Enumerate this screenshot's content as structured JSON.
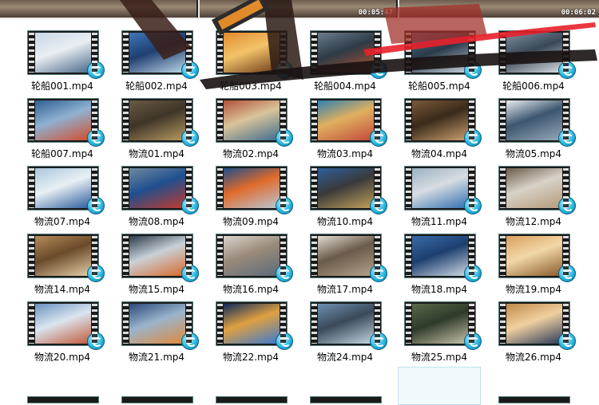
{
  "previews": [
    {
      "time": ""
    },
    {
      "time": "00:05:47"
    },
    {
      "time": "00:06:02"
    }
  ],
  "files": [
    {
      "name": "轮船001.mp4",
      "colors": [
        "#c9d8e6",
        "#4a6a8a",
        "#e9eef2"
      ]
    },
    {
      "name": "轮船002.mp4",
      "colors": [
        "#3e76b8",
        "#bcd6ea",
        "#1f3f70"
      ]
    },
    {
      "name": "轮船003.mp4",
      "colors": [
        "#e28a2b",
        "#6b3a17",
        "#f3c36a"
      ]
    },
    {
      "name": "轮船004.mp4",
      "colors": [
        "#6b7c8c",
        "#b5522f",
        "#2e3b47"
      ]
    },
    {
      "name": "轮船005.mp4",
      "colors": [
        "#59708a",
        "#c6d0d8",
        "#2a3a4a"
      ]
    },
    {
      "name": "轮船006.mp4",
      "colors": [
        "#7d8fa0",
        "#d6dde3",
        "#3a4856"
      ]
    },
    {
      "name": "轮船007.mp4",
      "colors": [
        "#2f5f91",
        "#d24c2a",
        "#8fb2d2"
      ]
    },
    {
      "name": "物流01.mp4",
      "colors": [
        "#6a5a45",
        "#b89a62",
        "#3e3528"
      ]
    },
    {
      "name": "物流02.mp4",
      "colors": [
        "#b4513a",
        "#3e6c8e",
        "#d9c49a"
      ]
    },
    {
      "name": "物流03.mp4",
      "colors": [
        "#2f7fb0",
        "#c24a3a",
        "#e0b060"
      ]
    },
    {
      "name": "物流04.mp4",
      "colors": [
        "#7a5a3a",
        "#caa070",
        "#3a2a1a"
      ]
    },
    {
      "name": "物流05.mp4",
      "colors": [
        "#e8ecef",
        "#97a9b9",
        "#3c566f"
      ]
    },
    {
      "name": "物流07.mp4",
      "colors": [
        "#a9c6dc",
        "#2b5c9a",
        "#e9f0f5"
      ]
    },
    {
      "name": "物流08.mp4",
      "colors": [
        "#6f8aa0",
        "#c23a2a",
        "#1f4f8f"
      ]
    },
    {
      "name": "物流09.mp4",
      "colors": [
        "#1d4e8c",
        "#b8c7d3",
        "#e06a2a"
      ]
    },
    {
      "name": "物流10.mp4",
      "colors": [
        "#2d5f9c",
        "#c0a05a",
        "#3a3a3a"
      ]
    },
    {
      "name": "物流11.mp4",
      "colors": [
        "#9ab0c0",
        "#2f6fb0",
        "#d8dde2"
      ]
    },
    {
      "name": "物流12.mp4",
      "colors": [
        "#6c5c4c",
        "#b49a78",
        "#d8d2c8"
      ]
    },
    {
      "name": "物流14.mp4",
      "colors": [
        "#b58b5a",
        "#e2cfa6",
        "#6a4a2a"
      ]
    },
    {
      "name": "物流15.mp4",
      "colors": [
        "#2a3a4a",
        "#d86a2a",
        "#c9d1d8"
      ]
    },
    {
      "name": "物流16.mp4",
      "colors": [
        "#d9d4cc",
        "#5c6a7a",
        "#9a8a7a"
      ]
    },
    {
      "name": "物流17.mp4",
      "colors": [
        "#e2ddd2",
        "#b4a28a",
        "#6a5a4a"
      ]
    },
    {
      "name": "物流18.mp4",
      "colors": [
        "#3a6aa8",
        "#d0dae4",
        "#1d3f6f"
      ]
    },
    {
      "name": "物流19.mp4",
      "colors": [
        "#d8a060",
        "#8a5a2a",
        "#f2d8a8"
      ]
    },
    {
      "name": "物流20.mp4",
      "colors": [
        "#6a92c0",
        "#c05a3a",
        "#dbe5ef"
      ]
    },
    {
      "name": "物流21.mp4",
      "colors": [
        "#2a4a7a",
        "#e08a3a",
        "#9ab4cc"
      ]
    },
    {
      "name": "物流22.mp4",
      "colors": [
        "#0f2a5a",
        "#3a7ad0",
        "#e0a040"
      ]
    },
    {
      "name": "物流24.mp4",
      "colors": [
        "#6e8fb0",
        "#c4d4e2",
        "#3a4a5a"
      ]
    },
    {
      "name": "物流25.mp4",
      "colors": [
        "#5a6a4a",
        "#c8c2a8",
        "#2e3a2a"
      ]
    },
    {
      "name": "物流26.mp4",
      "colors": [
        "#c08a4a",
        "#2a3a5a",
        "#f0d0a0"
      ]
    }
  ]
}
